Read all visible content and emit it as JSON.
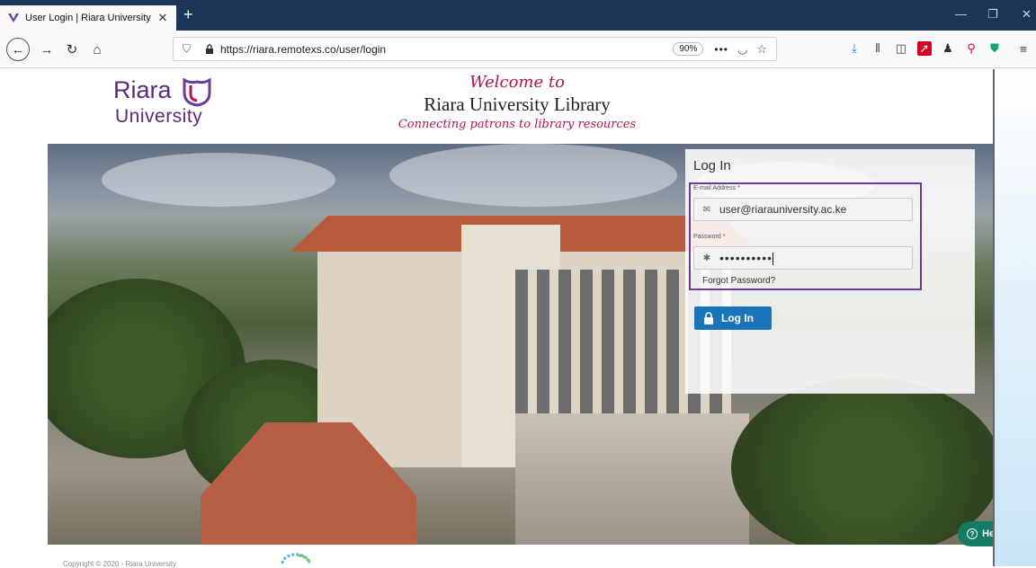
{
  "browser": {
    "tab_title": "User Login | Riara University",
    "url": "https://riara.remotexs.co/user/login",
    "zoom": "90%"
  },
  "header": {
    "logo_top": "Riara",
    "logo_bottom": "University",
    "welcome": "Welcome to",
    "library_name": "Riara University Library",
    "tagline": "Connecting patrons to library resources"
  },
  "login": {
    "title": "Log In",
    "email_label": "E-mail Address",
    "email_value": "user@riarauniversity.ac.ke",
    "password_label": "Password",
    "password_value": "••••••••••",
    "required_mark": "*",
    "forgot": "Forgot Password?",
    "button_label": "Log In"
  },
  "help": {
    "label": "Help"
  },
  "footer": {
    "copyright": "Copyright © 2020 - Riara University"
  },
  "colors": {
    "brand_purple": "#5a2a7a",
    "accent_red": "#b0164a",
    "button_blue": "#1a74b8",
    "help_green": "#137c63"
  }
}
